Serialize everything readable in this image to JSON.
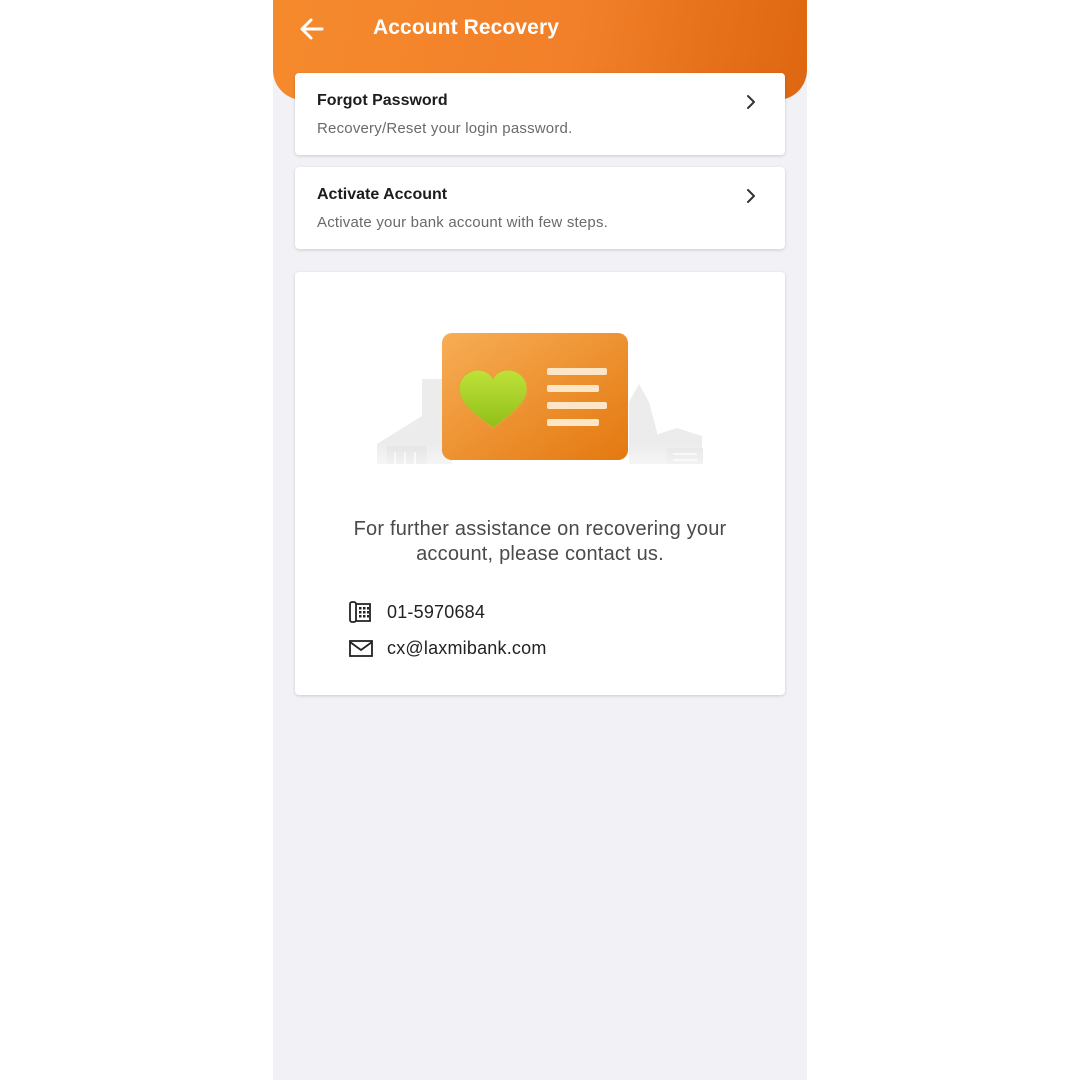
{
  "header": {
    "title": "Account Recovery",
    "back_icon": "arrow-left-icon"
  },
  "menu": [
    {
      "title": "Forgot Password",
      "subtitle": "Recovery/Reset your login password.",
      "icon": "chevron-right-icon"
    },
    {
      "title": "Activate Account",
      "subtitle": "Activate your bank account with few steps.",
      "icon": "chevron-right-icon"
    }
  ],
  "support": {
    "illustration": "id-card-heart-illustration",
    "message": "For further assistance on recovering your account, please contact us.",
    "phone": {
      "icon": "telephone-icon",
      "value": "01-5970684"
    },
    "email": {
      "icon": "mail-icon",
      "value": "cx@laxmibank.com"
    }
  },
  "colors": {
    "brand_orange": "#f2802a",
    "brand_orange_dark": "#de6610",
    "background": "#f2f2f6",
    "heart_green": "#a9d41f"
  }
}
